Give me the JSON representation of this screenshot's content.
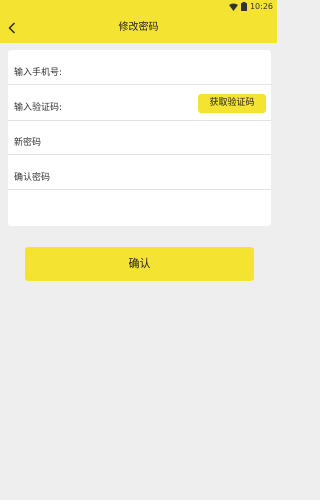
{
  "status_bar": {
    "time": "10:26",
    "icons": [
      "wifi-icon",
      "battery-icon"
    ]
  },
  "header": {
    "title": "修改密码",
    "back_icon": "back-arrow-icon"
  },
  "form": {
    "phone_placeholder": "输入手机号:",
    "phone_value": "",
    "code_placeholder": "输入验证码:",
    "code_value": "",
    "get_code_label": "获取验证码",
    "new_password_placeholder": "新密码",
    "new_password_value": "",
    "confirm_password_placeholder": "确认密码",
    "confirm_password_value": ""
  },
  "actions": {
    "confirm_label": "确认"
  },
  "colors": {
    "accent": "#f5e332",
    "background": "#eeeeee",
    "card": "#ffffff",
    "text": "#333333"
  }
}
